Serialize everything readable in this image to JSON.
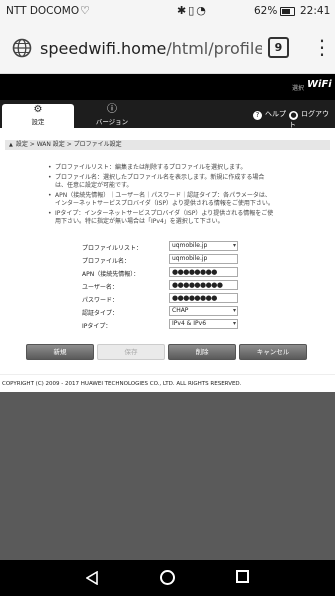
{
  "status_bar": {
    "carrier": "NTT DOCOMO",
    "battery": "62%",
    "time": "22:41"
  },
  "browser": {
    "url_host": "speedwifi.home",
    "url_path": "/html/profile.htm",
    "tab_count": "9"
  },
  "header": {
    "lang": "選択",
    "brand": "WiFi"
  },
  "nav": {
    "tabs": [
      {
        "label": "設定",
        "icon": "gear-icon"
      },
      {
        "label": "バージョン",
        "icon": "info-icon"
      }
    ],
    "help_label": "ヘルプ",
    "logout_label": "ログアウト"
  },
  "breadcrumb": "設定 > WAN 設定 > プロファイル設定",
  "notes": [
    "プロファイルリスト：編集または削除するプロファイルを選択します。",
    "プロファイル名：選択したプロファイル名を表示します。新規に作成する場合は、任意に設定が可能です。",
    "APN（接続先情報）｜ユーザー名｜パスワード｜認証タイプ：各パラメータは、インターネットサービスプロバイダ（ISP）より提供される情報をご使用下さい。",
    "IPタイプ：インターネットサービスプロバイダ（ISP）より提供される情報をご使用下さい。特に指定が無い場合は「IPv4」を選択して下さい。"
  ],
  "form": {
    "profile_list_label": "プロファイルリスト：",
    "profile_list_value": "uqmobile.jp",
    "profile_name_label": "プロファイル名：",
    "profile_name_value": "uqmobile.jp",
    "apn_label": "APN（接続先情報）：",
    "apn_value": "●●●●●●●●",
    "username_label": "ユーザー名：",
    "username_value": "●●●●●●●●●",
    "password_label": "パスワード：",
    "password_value": "●●●●●●●●",
    "auth_type_label": "認証タイプ：",
    "auth_type_value": "CHAP",
    "ip_type_label": "IPタイプ：",
    "ip_type_value": "IPv4 & IPv6"
  },
  "buttons": {
    "new": "新規",
    "save": "保存",
    "delete": "削除",
    "cancel": "キャンセル"
  },
  "footer": "COPYRIGHT (C) 2009 - 2017 HUAWEI TECHNOLOGIES CO., LTD. ALL RIGHTS RESERVED."
}
